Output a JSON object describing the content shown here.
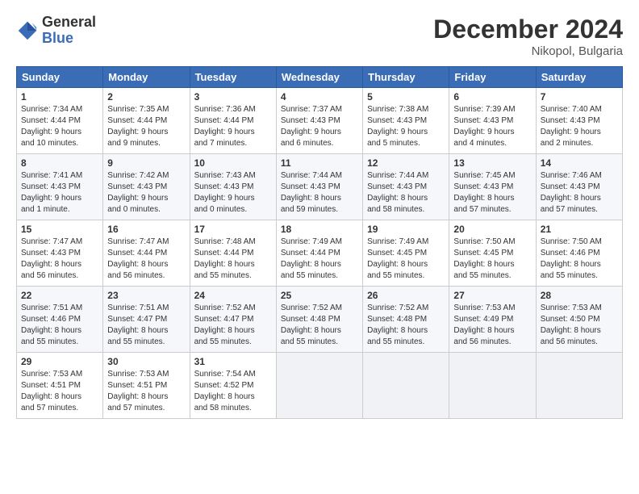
{
  "logo": {
    "general": "General",
    "blue": "Blue"
  },
  "header": {
    "title": "December 2024",
    "subtitle": "Nikopol, Bulgaria"
  },
  "weekdays": [
    "Sunday",
    "Monday",
    "Tuesday",
    "Wednesday",
    "Thursday",
    "Friday",
    "Saturday"
  ],
  "weeks": [
    [
      {
        "day": "1",
        "info": "Sunrise: 7:34 AM\nSunset: 4:44 PM\nDaylight: 9 hours\nand 10 minutes."
      },
      {
        "day": "2",
        "info": "Sunrise: 7:35 AM\nSunset: 4:44 PM\nDaylight: 9 hours\nand 9 minutes."
      },
      {
        "day": "3",
        "info": "Sunrise: 7:36 AM\nSunset: 4:44 PM\nDaylight: 9 hours\nand 7 minutes."
      },
      {
        "day": "4",
        "info": "Sunrise: 7:37 AM\nSunset: 4:43 PM\nDaylight: 9 hours\nand 6 minutes."
      },
      {
        "day": "5",
        "info": "Sunrise: 7:38 AM\nSunset: 4:43 PM\nDaylight: 9 hours\nand 5 minutes."
      },
      {
        "day": "6",
        "info": "Sunrise: 7:39 AM\nSunset: 4:43 PM\nDaylight: 9 hours\nand 4 minutes."
      },
      {
        "day": "7",
        "info": "Sunrise: 7:40 AM\nSunset: 4:43 PM\nDaylight: 9 hours\nand 2 minutes."
      }
    ],
    [
      {
        "day": "8",
        "info": "Sunrise: 7:41 AM\nSunset: 4:43 PM\nDaylight: 9 hours\nand 1 minute."
      },
      {
        "day": "9",
        "info": "Sunrise: 7:42 AM\nSunset: 4:43 PM\nDaylight: 9 hours\nand 0 minutes."
      },
      {
        "day": "10",
        "info": "Sunrise: 7:43 AM\nSunset: 4:43 PM\nDaylight: 9 hours\nand 0 minutes."
      },
      {
        "day": "11",
        "info": "Sunrise: 7:44 AM\nSunset: 4:43 PM\nDaylight: 8 hours\nand 59 minutes."
      },
      {
        "day": "12",
        "info": "Sunrise: 7:44 AM\nSunset: 4:43 PM\nDaylight: 8 hours\nand 58 minutes."
      },
      {
        "day": "13",
        "info": "Sunrise: 7:45 AM\nSunset: 4:43 PM\nDaylight: 8 hours\nand 57 minutes."
      },
      {
        "day": "14",
        "info": "Sunrise: 7:46 AM\nSunset: 4:43 PM\nDaylight: 8 hours\nand 57 minutes."
      }
    ],
    [
      {
        "day": "15",
        "info": "Sunrise: 7:47 AM\nSunset: 4:43 PM\nDaylight: 8 hours\nand 56 minutes."
      },
      {
        "day": "16",
        "info": "Sunrise: 7:47 AM\nSunset: 4:44 PM\nDaylight: 8 hours\nand 56 minutes."
      },
      {
        "day": "17",
        "info": "Sunrise: 7:48 AM\nSunset: 4:44 PM\nDaylight: 8 hours\nand 55 minutes."
      },
      {
        "day": "18",
        "info": "Sunrise: 7:49 AM\nSunset: 4:44 PM\nDaylight: 8 hours\nand 55 minutes."
      },
      {
        "day": "19",
        "info": "Sunrise: 7:49 AM\nSunset: 4:45 PM\nDaylight: 8 hours\nand 55 minutes."
      },
      {
        "day": "20",
        "info": "Sunrise: 7:50 AM\nSunset: 4:45 PM\nDaylight: 8 hours\nand 55 minutes."
      },
      {
        "day": "21",
        "info": "Sunrise: 7:50 AM\nSunset: 4:46 PM\nDaylight: 8 hours\nand 55 minutes."
      }
    ],
    [
      {
        "day": "22",
        "info": "Sunrise: 7:51 AM\nSunset: 4:46 PM\nDaylight: 8 hours\nand 55 minutes."
      },
      {
        "day": "23",
        "info": "Sunrise: 7:51 AM\nSunset: 4:47 PM\nDaylight: 8 hours\nand 55 minutes."
      },
      {
        "day": "24",
        "info": "Sunrise: 7:52 AM\nSunset: 4:47 PM\nDaylight: 8 hours\nand 55 minutes."
      },
      {
        "day": "25",
        "info": "Sunrise: 7:52 AM\nSunset: 4:48 PM\nDaylight: 8 hours\nand 55 minutes."
      },
      {
        "day": "26",
        "info": "Sunrise: 7:52 AM\nSunset: 4:48 PM\nDaylight: 8 hours\nand 55 minutes."
      },
      {
        "day": "27",
        "info": "Sunrise: 7:53 AM\nSunset: 4:49 PM\nDaylight: 8 hours\nand 56 minutes."
      },
      {
        "day": "28",
        "info": "Sunrise: 7:53 AM\nSunset: 4:50 PM\nDaylight: 8 hours\nand 56 minutes."
      }
    ],
    [
      {
        "day": "29",
        "info": "Sunrise: 7:53 AM\nSunset: 4:51 PM\nDaylight: 8 hours\nand 57 minutes."
      },
      {
        "day": "30",
        "info": "Sunrise: 7:53 AM\nSunset: 4:51 PM\nDaylight: 8 hours\nand 57 minutes."
      },
      {
        "day": "31",
        "info": "Sunrise: 7:54 AM\nSunset: 4:52 PM\nDaylight: 8 hours\nand 58 minutes."
      },
      {
        "day": "",
        "info": ""
      },
      {
        "day": "",
        "info": ""
      },
      {
        "day": "",
        "info": ""
      },
      {
        "day": "",
        "info": ""
      }
    ]
  ]
}
